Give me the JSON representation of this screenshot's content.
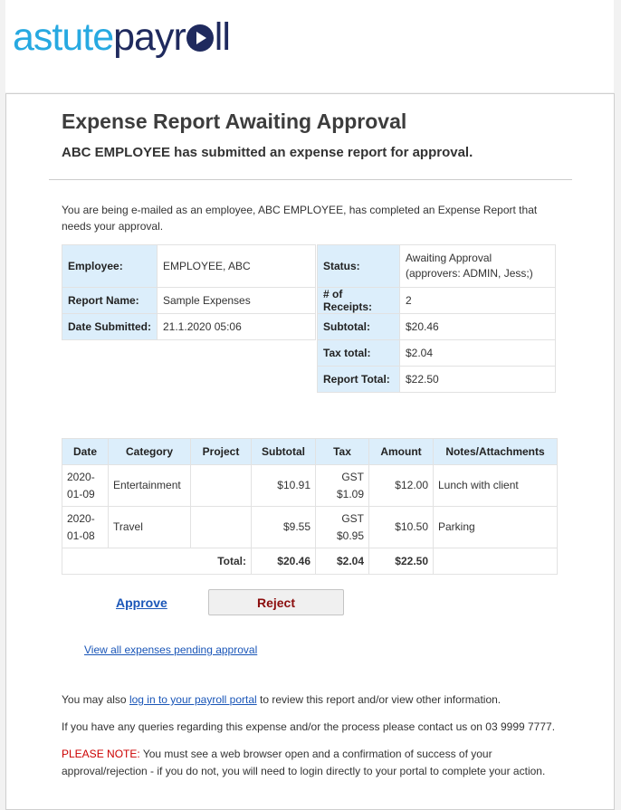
{
  "brand": {
    "part1": "astute",
    "part2": "payr",
    "part3": "ll"
  },
  "title": "Expense Report Awaiting Approval",
  "subtitle": "ABC EMPLOYEE has submitted an expense report for approval.",
  "intro": "You are being e-mailed as an employee, ABC EMPLOYEE, has completed an Expense Report that needs your approval.",
  "info": {
    "employee_label": "Employee:",
    "employee_value": "EMPLOYEE, ABC",
    "report_name_label": "Report Name:",
    "report_name_value": "Sample Expenses",
    "date_label": "Date Submitted:",
    "date_value": "21.1.2020 05:06",
    "status_label": "Status:",
    "status_value": "Awaiting Approval (approvers: ADMIN, Jess;)",
    "receipts_label": "# of Receipts:",
    "receipts_value": "2",
    "subtotal_label": "Subtotal:",
    "subtotal_value": "$20.46",
    "tax_label": "Tax total:",
    "tax_value": "$2.04",
    "total_label": "Report Total:",
    "total_value": "$22.50"
  },
  "table": {
    "headers": [
      "Date",
      "Category",
      "Project",
      "Subtotal",
      "Tax",
      "Amount",
      "Notes/Attachments"
    ],
    "rows": [
      {
        "date": "2020-01-09",
        "category": "Entertainment",
        "project": "",
        "subtotal": "$10.91",
        "tax_type": "GST",
        "tax": "$1.09",
        "amount": "$12.00",
        "notes": "Lunch with client"
      },
      {
        "date": "2020-01-08",
        "category": "Travel",
        "project": "",
        "subtotal": "$9.55",
        "tax_type": "GST",
        "tax": "$0.95",
        "amount": "$10.50",
        "notes": "Parking"
      }
    ],
    "total_label": "Total:",
    "total_subtotal": "$20.46",
    "total_tax": "$2.04",
    "total_amount": "$22.50"
  },
  "actions": {
    "approve": "Approve",
    "reject": "Reject",
    "view_all": "View all expenses pending approval"
  },
  "footer": {
    "line1_pre": "You may also ",
    "line1_link": "log in to your payroll portal",
    "line1_post": " to review this report and/or view other information.",
    "line2": "If you have any queries regarding this expense and/or the process please contact us on 03 9999 7777.",
    "note_label": "PLEASE NOTE:",
    "note_text": " You must see a web browser open and a confirmation of success of your approval/rejection - if you do not, you will need to login directly to your portal to complete your action."
  },
  "colors": {
    "brand_light": "#27a9e1",
    "brand_dark": "#1f2a5e",
    "header_bg": "#dceefb",
    "link": "#1a56b8",
    "reject_text": "#8b0d0d",
    "note": "#cc0000"
  }
}
